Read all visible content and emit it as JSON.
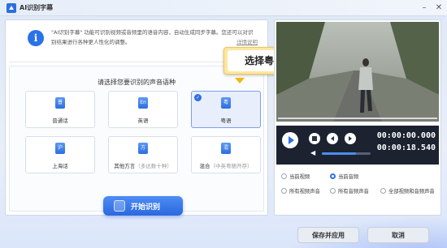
{
  "window": {
    "title": "AI识别字幕",
    "minimize_icon": "minimize-icon",
    "close_icon": "close-icon"
  },
  "info": {
    "icon": "info-icon",
    "text": "\"AI识别字幕\" 功能可识别视频或音频里的语音内容，自动生成同步字幕。您还可以对识别结果进行各种更人性化的调整。",
    "details_link": "详情说明"
  },
  "language": {
    "prompt": "请选择您要识别的声音语种",
    "options": [
      {
        "glyph": "普",
        "label": "普通话",
        "sub": ""
      },
      {
        "glyph": "En",
        "label": "英语",
        "sub": ""
      },
      {
        "glyph": "粤",
        "label": "粤语",
        "sub": "",
        "selected": true
      },
      {
        "glyph": "沪",
        "label": "上海话",
        "sub": ""
      },
      {
        "glyph": "方",
        "label": "其他方言",
        "sub": "（多达数十种）"
      },
      {
        "glyph": "混",
        "label": "混合",
        "sub": "（中英粤随开存）"
      }
    ]
  },
  "callout": {
    "text": "选择粤语"
  },
  "start_button": {
    "label": "开始识别"
  },
  "player": {
    "time_current": "00:00:00.000",
    "time_total": "00:00:18.540",
    "volume_level": 0.7
  },
  "scope_options": [
    {
      "label": "当前视频",
      "selected": false
    },
    {
      "label": "当前音频",
      "selected": true
    },
    {
      "label": "所有视频声音",
      "selected": false
    },
    {
      "label": "所有音频声音",
      "selected": false
    },
    {
      "label": "全部视频和音频声音",
      "selected": false
    }
  ],
  "footer": {
    "apply_label": "保存并应用",
    "cancel_label": "取消"
  },
  "colors": {
    "accent": "#2e6fe3",
    "callout_border": "#f2b60f"
  }
}
